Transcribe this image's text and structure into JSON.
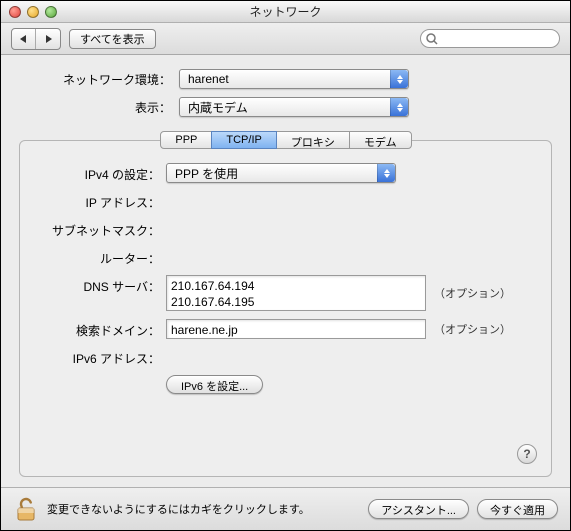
{
  "window": {
    "title": "ネットワーク"
  },
  "toolbar": {
    "show_all_label": "すべてを表示",
    "search_placeholder": ""
  },
  "selectors": {
    "location_label": "ネットワーク環境：",
    "location_value": "harenet",
    "show_label": "表示：",
    "show_value": "内蔵モデム"
  },
  "tabs": {
    "ppp": "PPP",
    "tcpip": "TCP/IP",
    "proxy": "プロキシ",
    "modem": "モデム"
  },
  "tcpip": {
    "ipv4_config_label": "IPv4 の設定：",
    "ipv4_config_value": "PPP を使用",
    "ip_address_label": "IP アドレス：",
    "subnet_label": "サブネットマスク：",
    "router_label": "ルーター：",
    "dns_label": "DNS サーバ：",
    "dns_values": [
      "210.167.64.194",
      "210.167.64.195"
    ],
    "search_domain_label": "検索ドメイン：",
    "search_domain_value": "harene.ne.jp",
    "ipv6_addr_label": "IPv6 アドレス：",
    "optional_label": "（オプション）",
    "configure_ipv6_button": "IPv6 を設定..."
  },
  "footer": {
    "lock_text": "変更できないようにするにはカギをクリックします。",
    "assistant_button": "アシスタント...",
    "apply_button": "今すぐ適用"
  }
}
